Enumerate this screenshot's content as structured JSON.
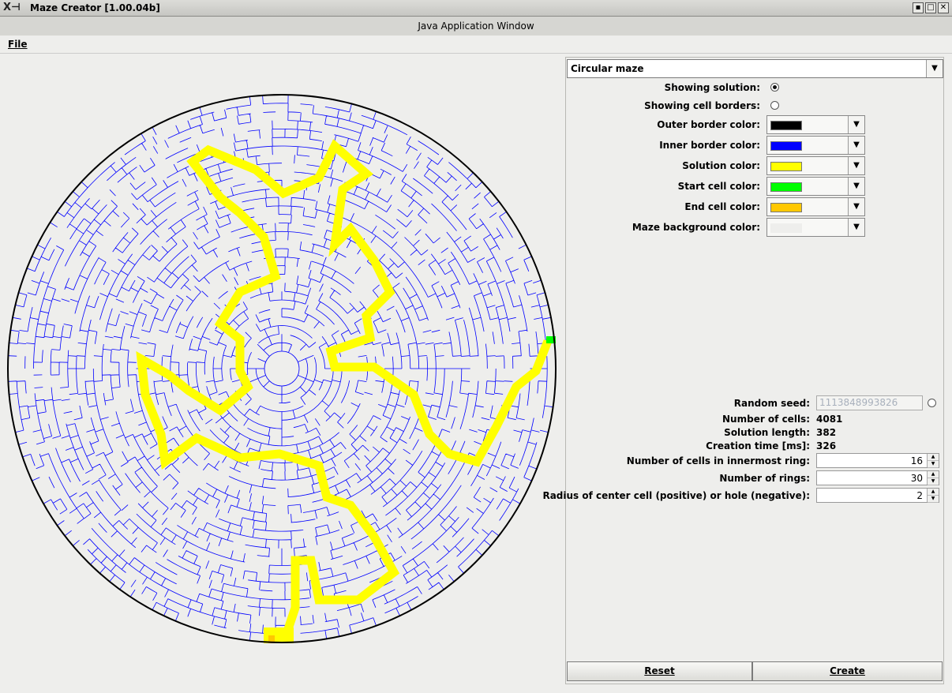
{
  "window": {
    "title": "Maze Creator [1.00.04b]",
    "subtitle": "Java Application Window",
    "icon": "x-logo-icon"
  },
  "menu": {
    "file": "File"
  },
  "maze_type": {
    "selected": "Circular maze"
  },
  "options": {
    "showing_solution_label": "Showing solution:",
    "showing_solution": true,
    "showing_borders_label": "Showing cell borders:",
    "showing_borders": false
  },
  "colors": [
    {
      "label": "Outer border color:",
      "color": "#000000"
    },
    {
      "label": "Inner border color:",
      "color": "#0000ff"
    },
    {
      "label": "Solution color:",
      "color": "#ffff00"
    },
    {
      "label": "Start cell color:",
      "color": "#00ff00"
    },
    {
      "label": "End cell color:",
      "color": "#ffc800"
    },
    {
      "label": "Maze background color:",
      "color": "#eeeeec"
    }
  ],
  "stats": {
    "seed_label": "Random seed:",
    "seed_value": "1113848993826",
    "cells_label": "Number of cells:",
    "cells_value": "4081",
    "solution_label": "Solution length:",
    "solution_value": "382",
    "time_label": "Creation time [ms]:",
    "time_value": "326"
  },
  "params": {
    "inner_ring_label": "Number of cells in innermost ring:",
    "inner_ring_value": "16",
    "rings_label": "Number of rings:",
    "rings_value": "30",
    "radius_label": "Radius of center cell (positive) or hole (negative):",
    "radius_value": "2"
  },
  "buttons": {
    "reset": "Reset",
    "create": "Create"
  }
}
